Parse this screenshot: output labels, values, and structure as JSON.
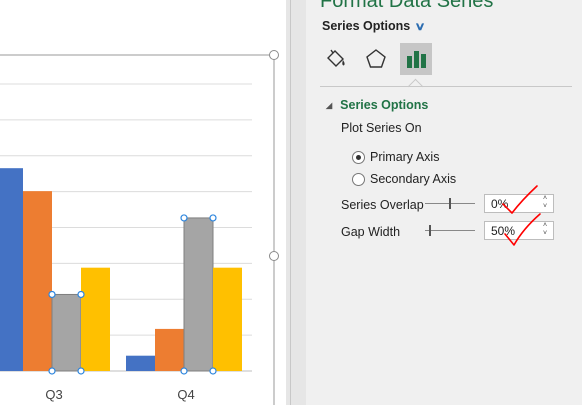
{
  "chart": {
    "categories": [
      "Q3",
      "Q4"
    ],
    "series": [
      {
        "color": "#4472c4",
        "values": [
          53,
          4
        ]
      },
      {
        "color": "#ed7d31",
        "values": [
          47,
          11
        ]
      },
      {
        "color": "#a5a5a5",
        "values": [
          20,
          40
        ]
      },
      {
        "color": "#ffc000",
        "values": [
          27,
          27
        ]
      }
    ],
    "selected_series_index": 2,
    "ymax": 75,
    "gridline_count": 8
  },
  "pane": {
    "title": "Format Data Series",
    "dropdown_label": "Series Options",
    "section_title": "Series Options",
    "plot_series_on": "Plot Series On",
    "primary_axis": "Primary Axis",
    "secondary_axis": "Secondary Axis",
    "primary_selected": true,
    "series_overlap_label": "Series Overlap",
    "series_overlap_value": "0%",
    "series_overlap_level": 0.5,
    "gap_width_label": "Gap Width",
    "gap_width_value": "50%",
    "gap_width_level": 0.1,
    "annotation_color": "#ff0000"
  },
  "icons": [
    "fill-line-icon",
    "effects-icon",
    "series-options-icon"
  ]
}
